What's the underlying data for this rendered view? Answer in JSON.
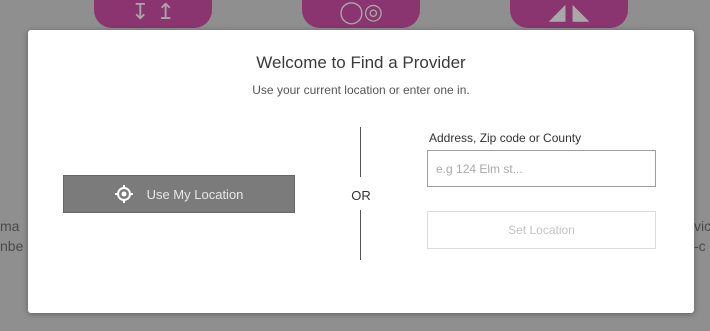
{
  "background": {
    "left_fragment": "ma\nnbe",
    "right_fragment": "vic\n-c"
  },
  "modal": {
    "title": "Welcome to Find a Provider",
    "subtitle": "Use your current location or enter one in.",
    "use_location_label": "Use My Location",
    "use_location_icon": "crosshair-location-icon",
    "or_label": "OR",
    "address_label": "Address, Zip code or County",
    "address_placeholder": "e.g 124 Elm st...",
    "address_value": "",
    "set_location_label": "Set Location"
  },
  "colors": {
    "brand_magenta": "#8a3570",
    "button_gray": "#7b7b7b",
    "overlay_gray": "#8f8f8f"
  }
}
